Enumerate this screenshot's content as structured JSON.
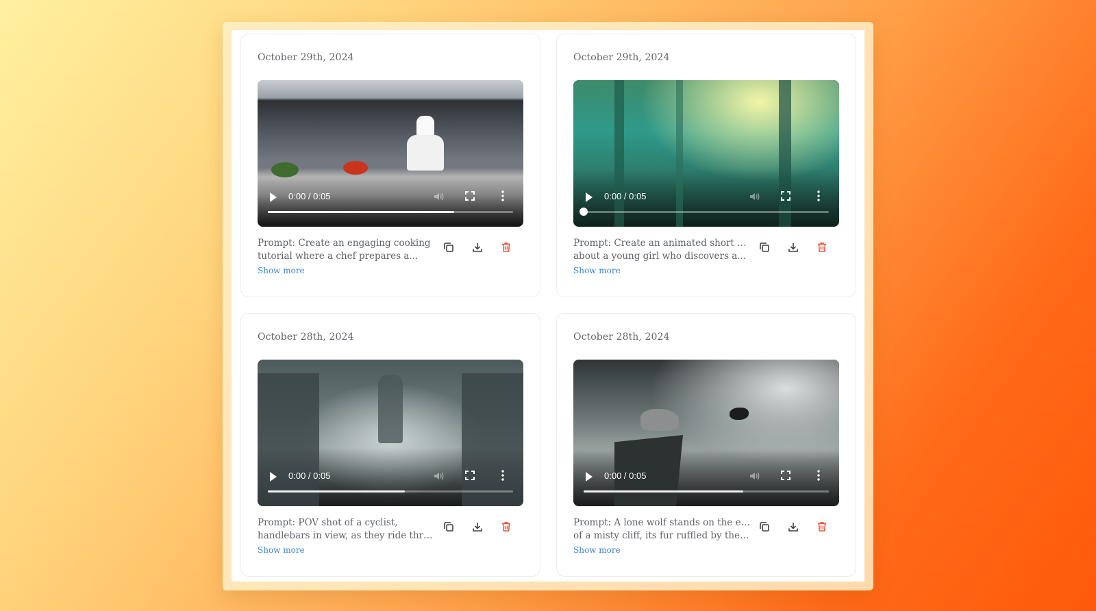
{
  "colors": {
    "date_text": "#5f6368",
    "show_more_link": "#3b82d6",
    "delete_icon": "#e8533a",
    "icon_default": "#3c4043"
  },
  "cards": [
    {
      "date": "October 29th, 2024",
      "video": {
        "time": "0:00 / 0:05",
        "progress": 0.76,
        "knob_visible": false
      },
      "prompt_line1": "Prompt: Create an engaging cooking",
      "prompt_line2": "tutorial where a chef prepares a...",
      "show_more": "Show more",
      "icons": [
        "copy-icon",
        "download-icon",
        "trash-icon"
      ]
    },
    {
      "date": "October 29th, 2024",
      "video": {
        "time": "0:00 / 0:05",
        "progress": 0.0,
        "knob_visible": true
      },
      "prompt_line1": "Prompt: Create an animated short film",
      "prompt_line2": "about a young girl who discovers a...",
      "show_more": "Show more",
      "icons": [
        "copy-icon",
        "download-icon",
        "trash-icon"
      ]
    },
    {
      "date": "October 28th, 2024",
      "video": {
        "time": "0:00 / 0:05",
        "progress": 0.56,
        "knob_visible": false
      },
      "prompt_line1": "Prompt: POV shot of a cyclist,",
      "prompt_line2": "handlebars in view, as they ride throug...",
      "show_more": "Show more",
      "icons": [
        "copy-icon",
        "download-icon",
        "trash-icon"
      ]
    },
    {
      "date": "October 28th, 2024",
      "video": {
        "time": "0:00 / 0:05",
        "progress": 0.65,
        "knob_visible": false
      },
      "prompt_line1": "Prompt: A lone wolf stands on the edge",
      "prompt_line2": "of a misty cliff, its fur ruffled by the wi...",
      "show_more": "Show more",
      "icons": [
        "copy-icon",
        "download-icon",
        "trash-icon"
      ]
    }
  ]
}
